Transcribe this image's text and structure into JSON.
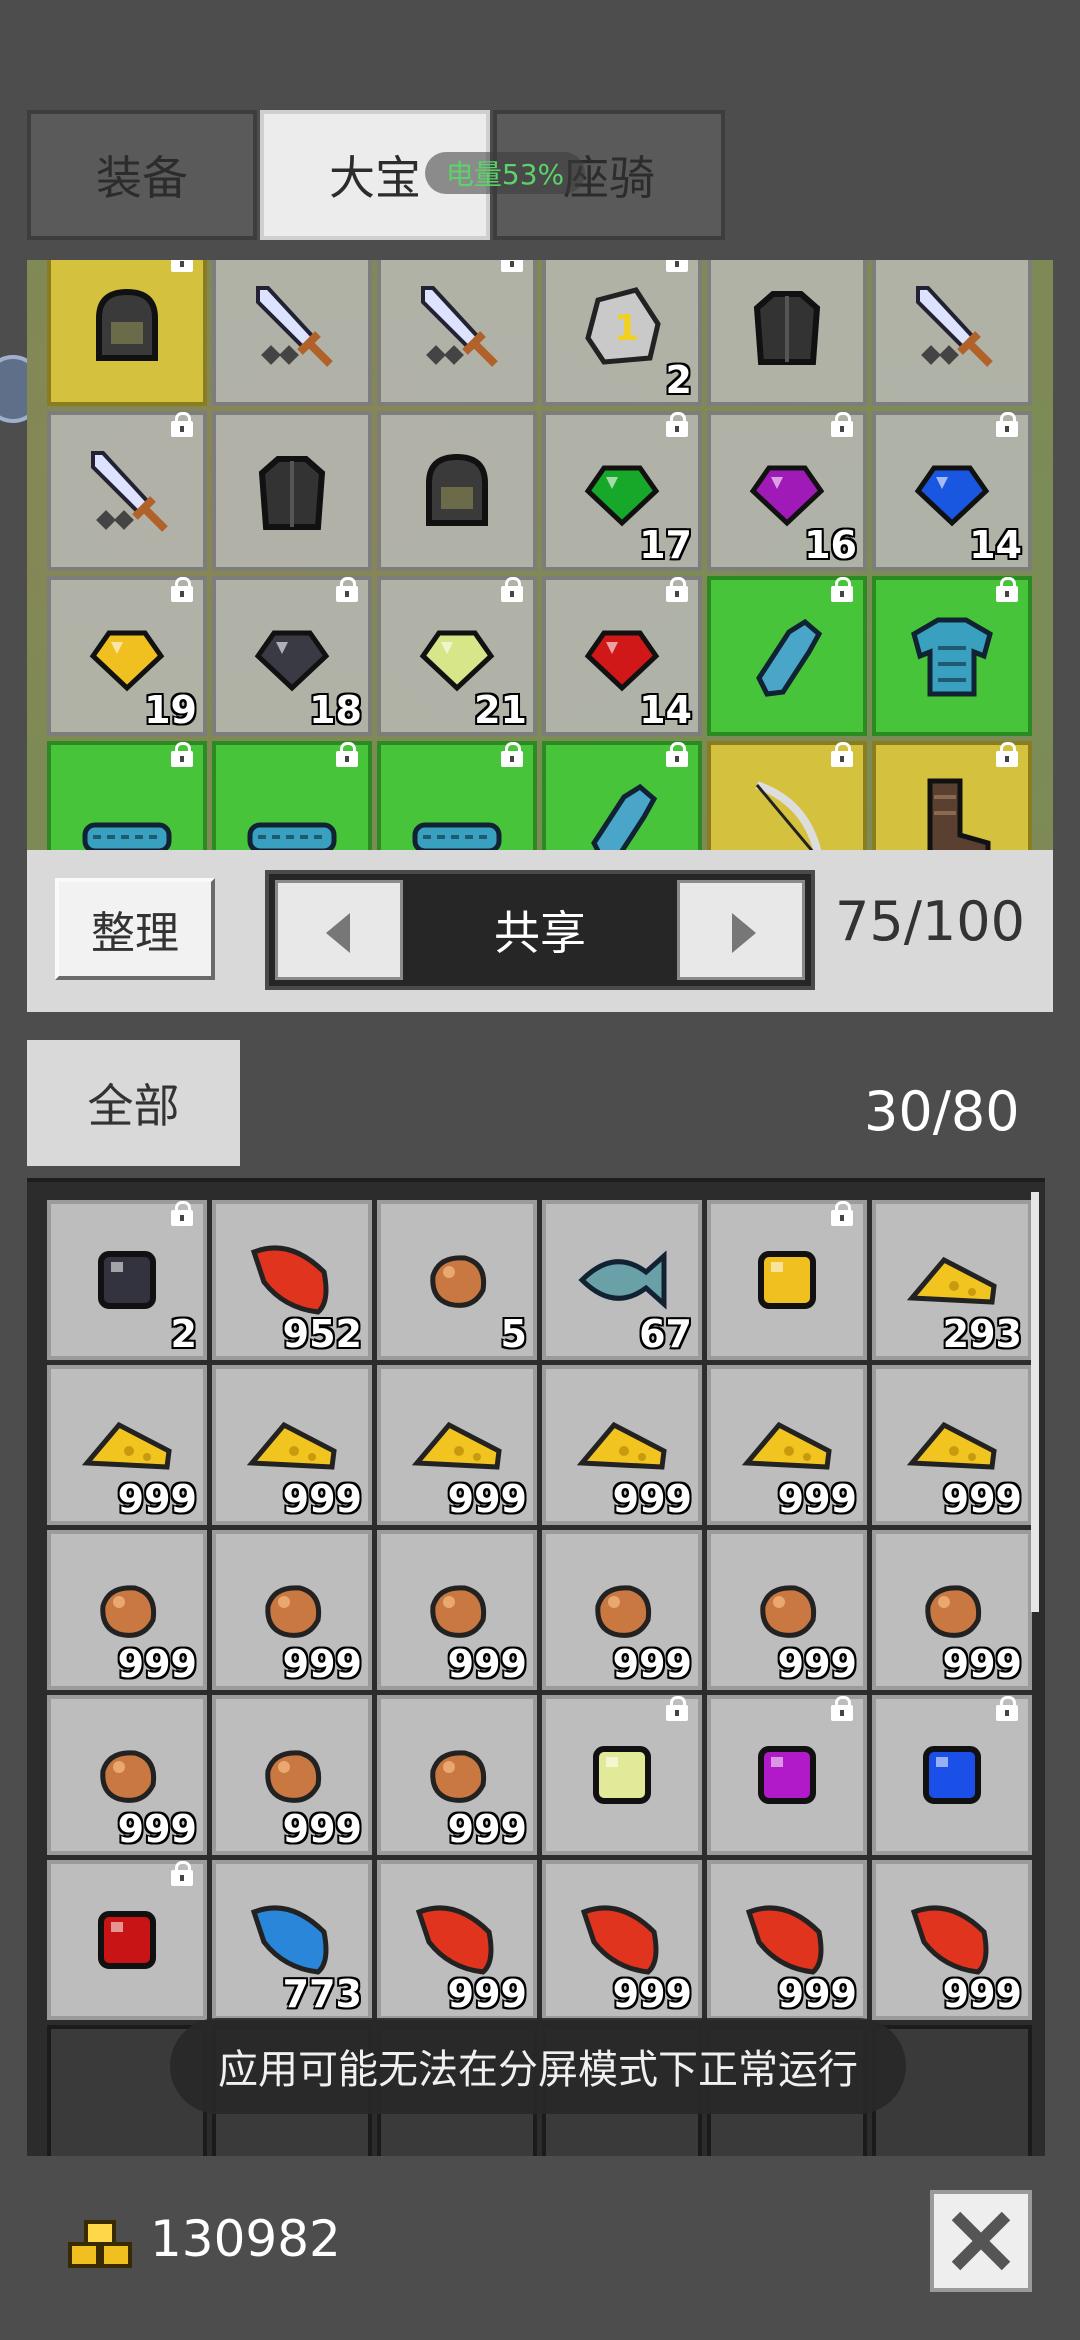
{
  "tabs": [
    {
      "label": "装备"
    },
    {
      "label": "大宝"
    },
    {
      "label": "座骑"
    }
  ],
  "status_overlay": {
    "battery": "电量53%"
  },
  "top_bag": {
    "items": [
      {
        "icon": "helmet",
        "quality": "yellow",
        "count": "",
        "locked": true
      },
      {
        "icon": "sword",
        "quality": "normal",
        "count": "",
        "locked": false
      },
      {
        "icon": "sword",
        "quality": "normal",
        "count": "",
        "locked": true
      },
      {
        "icon": "scroll-stone",
        "quality": "normal",
        "count": "2",
        "locked": true
      },
      {
        "icon": "armor",
        "quality": "normal",
        "count": "",
        "locked": false
      },
      {
        "icon": "sword",
        "quality": "normal",
        "count": "",
        "locked": false
      },
      {
        "icon": "sword",
        "quality": "normal",
        "count": "",
        "locked": true
      },
      {
        "icon": "armor",
        "quality": "normal",
        "count": "",
        "locked": false
      },
      {
        "icon": "helmet",
        "quality": "normal",
        "count": "",
        "locked": false
      },
      {
        "icon": "gem-green",
        "quality": "normal",
        "count": "17",
        "locked": true
      },
      {
        "icon": "gem-purple",
        "quality": "normal",
        "count": "16",
        "locked": true
      },
      {
        "icon": "gem-blue",
        "quality": "normal",
        "count": "14",
        "locked": true
      },
      {
        "icon": "gem-yellow",
        "quality": "normal",
        "count": "19",
        "locked": true
      },
      {
        "icon": "gem-black",
        "quality": "normal",
        "count": "18",
        "locked": true
      },
      {
        "icon": "gem-lime",
        "quality": "normal",
        "count": "21",
        "locked": true
      },
      {
        "icon": "gem-red",
        "quality": "normal",
        "count": "14",
        "locked": true
      },
      {
        "icon": "glove",
        "quality": "green",
        "count": "",
        "locked": true
      },
      {
        "icon": "tunic",
        "quality": "green",
        "count": "",
        "locked": true
      },
      {
        "icon": "belt",
        "quality": "green",
        "count": "",
        "locked": true
      },
      {
        "icon": "belt",
        "quality": "green",
        "count": "",
        "locked": true
      },
      {
        "icon": "belt",
        "quality": "green",
        "count": "",
        "locked": true
      },
      {
        "icon": "glove",
        "quality": "green",
        "count": "",
        "locked": true
      },
      {
        "icon": "bow",
        "quality": "yellow",
        "count": "",
        "locked": true
      },
      {
        "icon": "boots",
        "quality": "yellow",
        "count": "",
        "locked": true
      }
    ]
  },
  "controls": {
    "sort_label": "整理",
    "page_label": "共享",
    "capacity": "75/100"
  },
  "lower": {
    "tab_label": "全部",
    "capacity": "30/80",
    "items": [
      {
        "icon": "ore-dark",
        "count": "2",
        "locked": true
      },
      {
        "icon": "leaf-red",
        "count": "952",
        "locked": false
      },
      {
        "icon": "nugget",
        "count": "5",
        "locked": false
      },
      {
        "icon": "fish",
        "count": "67",
        "locked": false
      },
      {
        "icon": "cube-gold",
        "count": "",
        "locked": true
      },
      {
        "icon": "cheese",
        "count": "293",
        "locked": false
      },
      {
        "icon": "cheese",
        "count": "999",
        "locked": false
      },
      {
        "icon": "cheese",
        "count": "999",
        "locked": false
      },
      {
        "icon": "cheese",
        "count": "999",
        "locked": false
      },
      {
        "icon": "cheese",
        "count": "999",
        "locked": false
      },
      {
        "icon": "cheese",
        "count": "999",
        "locked": false
      },
      {
        "icon": "cheese",
        "count": "999",
        "locked": false
      },
      {
        "icon": "nugget",
        "count": "999",
        "locked": false
      },
      {
        "icon": "nugget",
        "count": "999",
        "locked": false
      },
      {
        "icon": "nugget",
        "count": "999",
        "locked": false
      },
      {
        "icon": "nugget",
        "count": "999",
        "locked": false
      },
      {
        "icon": "nugget",
        "count": "999",
        "locked": false
      },
      {
        "icon": "nugget",
        "count": "999",
        "locked": false
      },
      {
        "icon": "nugget",
        "count": "999",
        "locked": false
      },
      {
        "icon": "nugget",
        "count": "999",
        "locked": false
      },
      {
        "icon": "nugget",
        "count": "999",
        "locked": false
      },
      {
        "icon": "cube-lime",
        "count": "",
        "locked": true
      },
      {
        "icon": "cube-purple",
        "count": "",
        "locked": true
      },
      {
        "icon": "cube-blue",
        "count": "",
        "locked": true
      },
      {
        "icon": "cube-red",
        "count": "",
        "locked": true
      },
      {
        "icon": "leaf-blue",
        "count": "773",
        "locked": false
      },
      {
        "icon": "leaf-red",
        "count": "999",
        "locked": false
      },
      {
        "icon": "leaf-red",
        "count": "999",
        "locked": false
      },
      {
        "icon": "leaf-red",
        "count": "999",
        "locked": false
      },
      {
        "icon": "leaf-red",
        "count": "999",
        "locked": false
      }
    ],
    "empty_slots": 6
  },
  "toast": "应用可能无法在分屏模式下正常运行",
  "footer": {
    "gold": "130982"
  },
  "colors": {
    "gem-green": "#17a82a",
    "gem-purple": "#a01ab8",
    "gem-blue": "#1a57e0",
    "gem-yellow": "#f0c020",
    "gem-black": "#3a3a44",
    "gem-lime": "#d8e68a",
    "gem-red": "#d01818"
  }
}
